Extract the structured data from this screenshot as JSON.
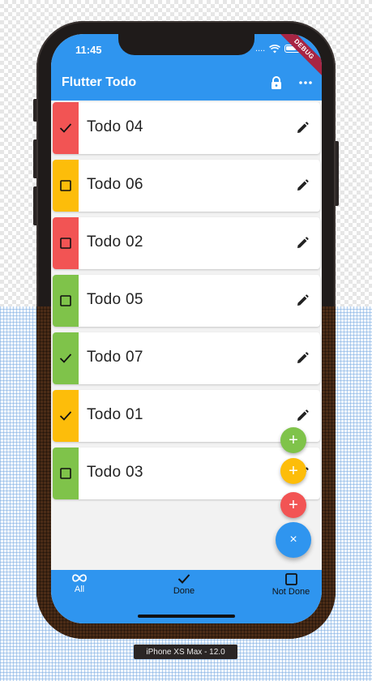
{
  "status_bar": {
    "time": "11:45",
    "signal_text": "...."
  },
  "debug_banner": "DEBUG",
  "app_bar": {
    "title": "Flutter Todo",
    "actions": [
      {
        "icon": "lock-icon"
      },
      {
        "icon": "more-horizontal-icon"
      }
    ]
  },
  "todos": [
    {
      "label": "Todo 04",
      "done": true,
      "color": "#f25454"
    },
    {
      "label": "Todo 06",
      "done": false,
      "color": "#fdbd0a"
    },
    {
      "label": "Todo 02",
      "done": false,
      "color": "#f25454"
    },
    {
      "label": "Todo 05",
      "done": false,
      "color": "#7fc34a"
    },
    {
      "label": "Todo 07",
      "done": true,
      "color": "#7fc34a"
    },
    {
      "label": "Todo 01",
      "done": true,
      "color": "#fdbd0a"
    },
    {
      "label": "Todo 03",
      "done": false,
      "color": "#7fc34a"
    }
  ],
  "fabs": {
    "add": [
      {
        "symbol": "+",
        "color": "#7fc34a"
      },
      {
        "symbol": "+",
        "color": "#fdbd0a"
      },
      {
        "symbol": "+",
        "color": "#f25454"
      }
    ],
    "main_symbol": "×",
    "main_color": "#2f95ef"
  },
  "bottom_nav": {
    "items": [
      {
        "label": "All",
        "icon": "infinity-icon"
      },
      {
        "label": "Done",
        "icon": "check-icon"
      },
      {
        "label": "Not Done",
        "icon": "checkbox-outline-icon"
      }
    ]
  },
  "device_label": "iPhone XS Max - 12.0",
  "colors": {
    "primary": "#2f95ef",
    "red": "#f25454",
    "yellow": "#fdbd0a",
    "green": "#7fc34a"
  }
}
